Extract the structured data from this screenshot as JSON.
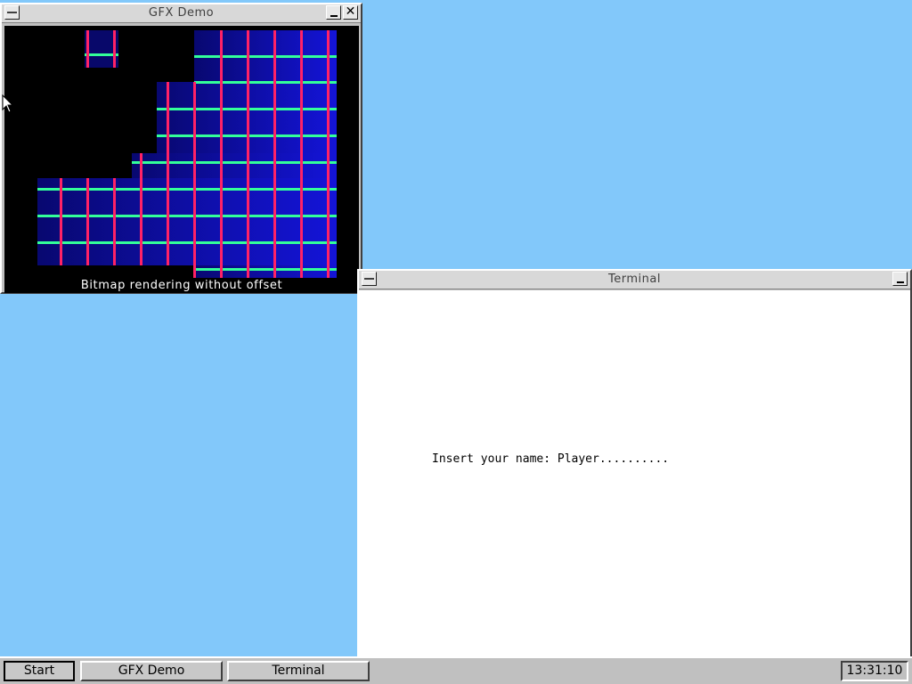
{
  "gfx_window": {
    "title": "GFX Demo",
    "caption": "Bitmap rendering without offset",
    "icons": {
      "system": "window-menu-icon",
      "minimize": "minimize-icon",
      "close": "close-icon"
    },
    "colors": {
      "background": "#000000",
      "tile": "#0a0aa0",
      "vertical_line": "#ff2266",
      "horizontal_line": "#33ff99"
    }
  },
  "terminal_window": {
    "title": "Terminal",
    "line": "Insert your name: Player..........",
    "icons": {
      "system": "window-menu-icon",
      "minimize": "minimize-icon"
    }
  },
  "taskbar": {
    "start_label": "Start",
    "tasks": [
      "GFX Demo",
      "Terminal"
    ],
    "clock": "13:31:10"
  },
  "desktop": {
    "background": "#82c8fa"
  }
}
